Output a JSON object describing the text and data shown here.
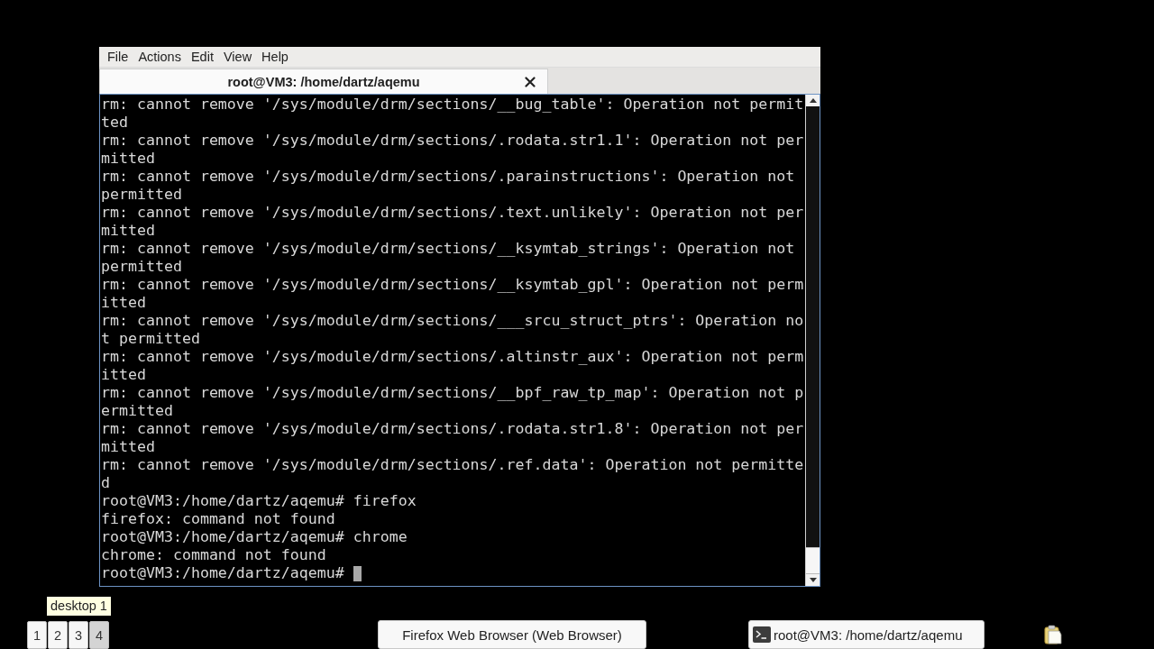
{
  "window": {
    "menu": [
      "File",
      "Actions",
      "Edit",
      "View",
      "Help"
    ],
    "tabs": [
      {
        "title": "root@VM3: /home/dartz/aqemu",
        "selected": true
      }
    ],
    "terminal": {
      "lines": [
        "rm: cannot remove '/sys/module/drm/sections/__bug_table': Operation not permit",
        "ted",
        "rm: cannot remove '/sys/module/drm/sections/.rodata.str1.1': Operation not per",
        "mitted",
        "rm: cannot remove '/sys/module/drm/sections/.parainstructions': Operation not",
        "permitted",
        "rm: cannot remove '/sys/module/drm/sections/.text.unlikely': Operation not per",
        "mitted",
        "rm: cannot remove '/sys/module/drm/sections/__ksymtab_strings': Operation not",
        "permitted",
        "rm: cannot remove '/sys/module/drm/sections/__ksymtab_gpl': Operation not perm",
        "itted",
        "rm: cannot remove '/sys/module/drm/sections/___srcu_struct_ptrs': Operation no",
        "t permitted",
        "rm: cannot remove '/sys/module/drm/sections/.altinstr_aux': Operation not perm",
        "itted",
        "rm: cannot remove '/sys/module/drm/sections/__bpf_raw_tp_map': Operation not p",
        "ermitted",
        "rm: cannot remove '/sys/module/drm/sections/.rodata.str1.8': Operation not per",
        "mitted",
        "rm: cannot remove '/sys/module/drm/sections/.ref.data': Operation not permitte",
        "d",
        "root@VM3:/home/dartz/aqemu# firefox",
        "firefox: command not found",
        "root@VM3:/home/dartz/aqemu# chrome",
        "chrome: command not found",
        "root@VM3:/home/dartz/aqemu#"
      ],
      "cursor": true
    }
  },
  "taskbar": {
    "tooltip": "desktop 1",
    "desktops": [
      {
        "label": "1",
        "selected": false
      },
      {
        "label": "2",
        "selected": false
      },
      {
        "label": "3",
        "selected": false
      },
      {
        "label": "4",
        "selected": true
      }
    ],
    "tasks": [
      {
        "label": "Firefox Web Browser (Web Browser)",
        "kind": "browser"
      },
      {
        "label": "root@VM3: /home/dartz/aqemu",
        "kind": "terminal"
      }
    ]
  }
}
